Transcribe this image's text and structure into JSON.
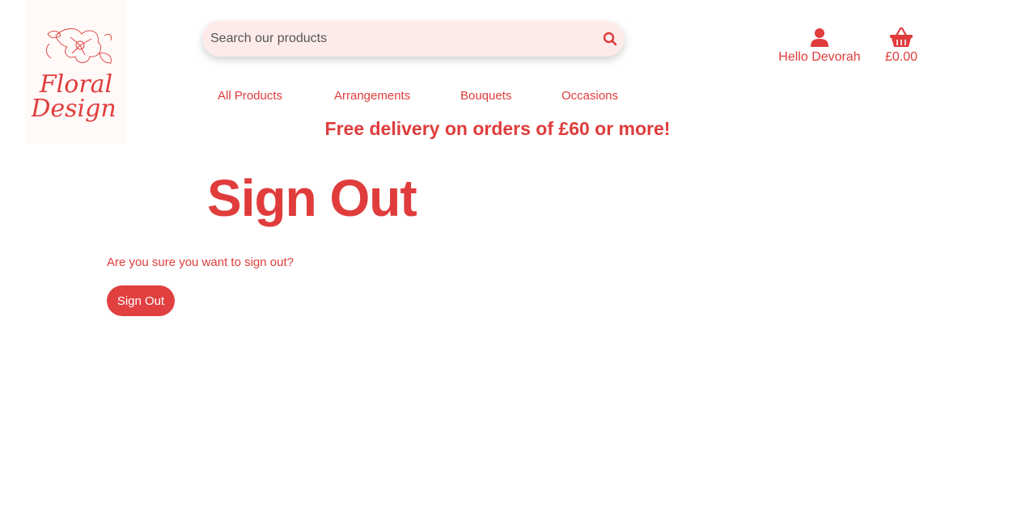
{
  "brand": {
    "logo_line1": "Floral",
    "logo_line2": "Design"
  },
  "search": {
    "placeholder": "Search our products",
    "icon": "search-icon"
  },
  "header": {
    "account_icon": "user-icon",
    "account_label": "Hello Devorah",
    "cart_icon": "basket-icon",
    "cart_total": "£0.00"
  },
  "nav": {
    "items": [
      {
        "label": "All Products"
      },
      {
        "label": "Arrangements"
      },
      {
        "label": "Bouquets"
      },
      {
        "label": "Occasions"
      }
    ]
  },
  "banner": {
    "text": "Free delivery on orders of £60 or more!"
  },
  "main": {
    "title": "Sign Out",
    "prompt": "Are you sure you want to sign out?",
    "button_label": "Sign Out"
  },
  "colors": {
    "accent": "#e03c3c",
    "search_bg": "#fdebea",
    "button_bg": "#e04040"
  }
}
